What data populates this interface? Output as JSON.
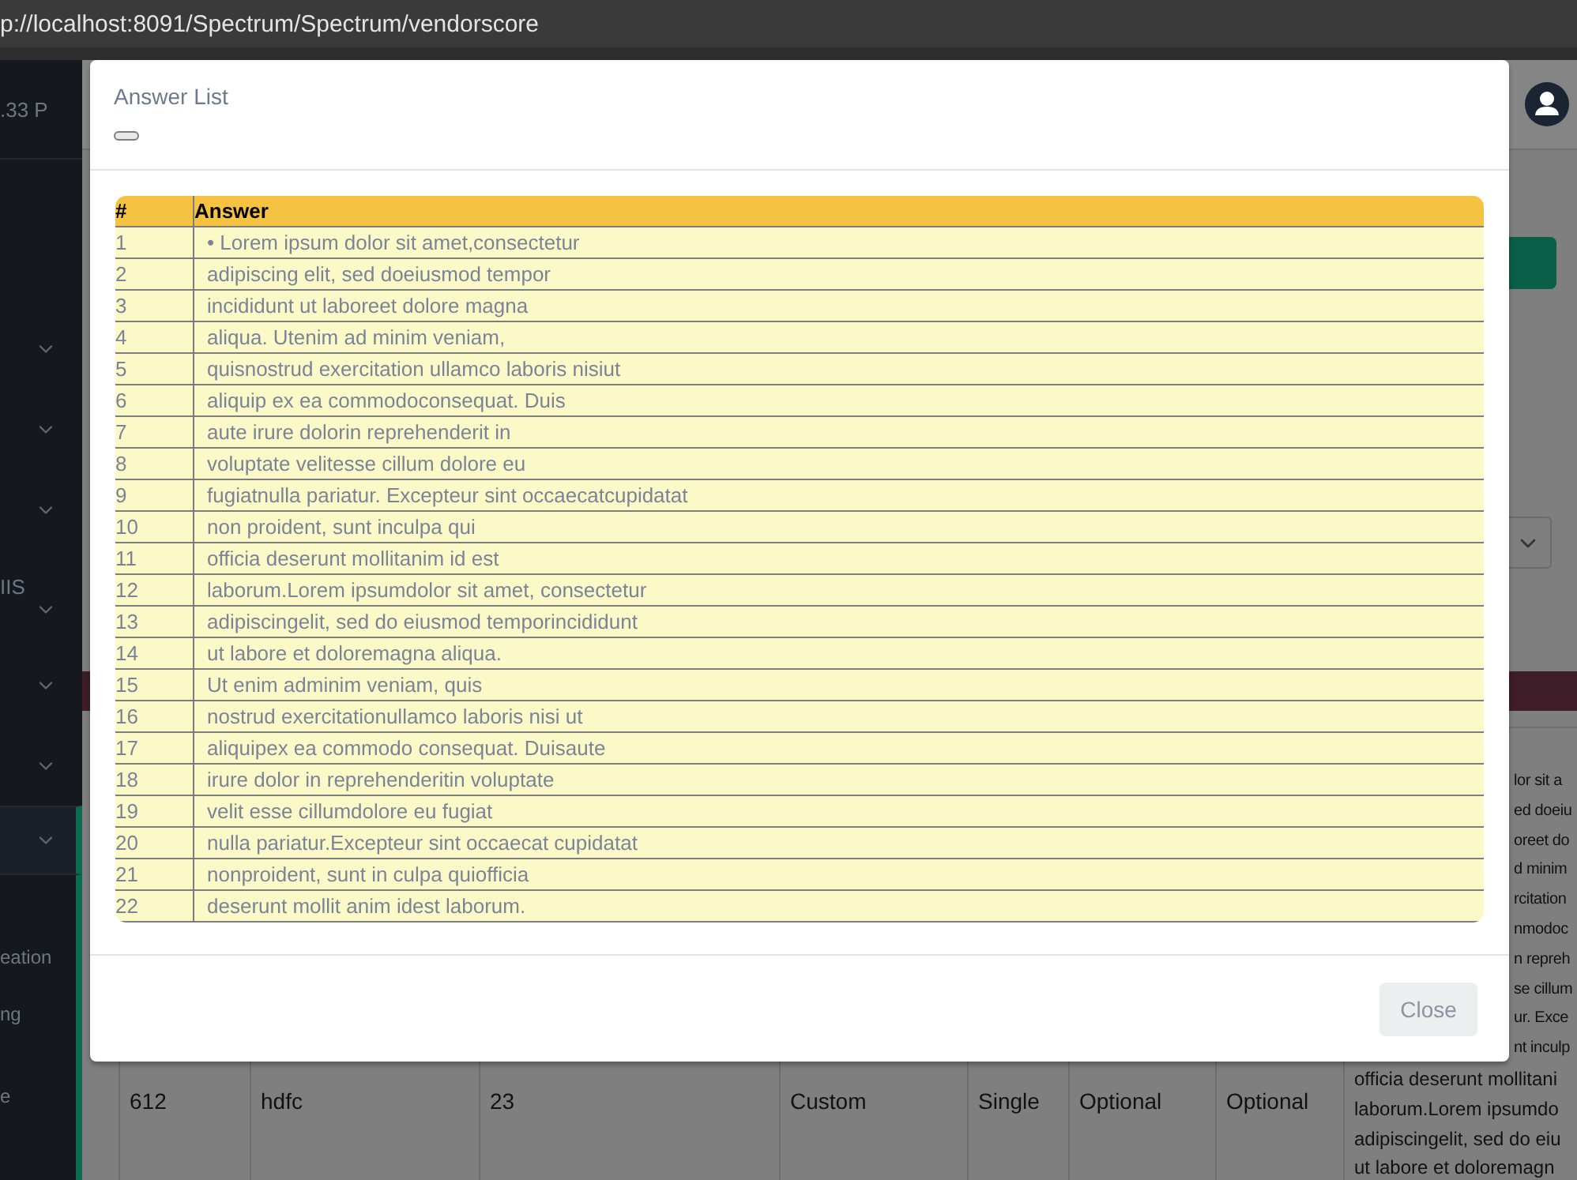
{
  "browser": {
    "url": "p://localhost:8091/Spectrum/Spectrum/vendorscore"
  },
  "sidebar": {
    "header": ".33 P",
    "items": [
      {
        "kind": "toggle",
        "selected": false
      },
      {
        "kind": "toggle",
        "selected": false
      },
      {
        "kind": "toggle",
        "selected": false
      },
      {
        "kind": "labeled",
        "label": "IIS",
        "selected": false
      },
      {
        "kind": "toggle",
        "selected": false
      },
      {
        "kind": "toggle",
        "selected": false
      },
      {
        "kind": "group",
        "selected": true,
        "children": [
          "eation",
          "ng",
          "e"
        ]
      }
    ]
  },
  "background_table": {
    "row": [
      "612",
      "hdfc",
      "23",
      "Custom",
      "Single",
      "Optional",
      "Optional"
    ],
    "long_cell_fragments": [
      "lor sit a",
      "ed doeiu",
      "oreet do",
      "d minim",
      "rcitation",
      "nmodoc",
      "n repreh",
      "se cillum",
      "ur. Exce",
      "nt inculp"
    ],
    "long_cell_lines": [
      "officia deserunt mollitani",
      "laborum.Lorem ipsumdo",
      "adipiscingelit, sed do eiu",
      "ut labore et doloremagn"
    ]
  },
  "modal": {
    "title": "Answer List",
    "columns": [
      "#",
      "Answer"
    ],
    "rows": [
      [
        "1",
        "• Lorem ipsum dolor sit amet,consectetur"
      ],
      [
        "2",
        "adipiscing elit, sed doeiusmod tempor"
      ],
      [
        "3",
        "incididunt ut laboreet dolore magna"
      ],
      [
        "4",
        "aliqua. Utenim ad minim veniam,"
      ],
      [
        "5",
        "quisnostrud exercitation ullamco laboris nisiut"
      ],
      [
        "6",
        "aliquip ex ea commodoconsequat. Duis"
      ],
      [
        "7",
        "aute irure dolorin reprehenderit in"
      ],
      [
        "8",
        "voluptate velitesse cillum dolore eu"
      ],
      [
        "9",
        "fugiatnulla pariatur. Excepteur sint occaecatcupidatat"
      ],
      [
        "10",
        "non proident, sunt inculpa qui"
      ],
      [
        "11",
        "officia deserunt mollitanim id est"
      ],
      [
        "12",
        "laborum.Lorem ipsumdolor sit amet, consectetur"
      ],
      [
        "13",
        "adipiscingelit, sed do eiusmod temporincididunt"
      ],
      [
        "14",
        "ut labore et doloremagna aliqua."
      ],
      [
        "15",
        "Ut enim adminim veniam, quis"
      ],
      [
        "16",
        "nostrud exercitationullamco laboris nisi ut"
      ],
      [
        "17",
        "aliquipex ea commodo consequat. Duisaute"
      ],
      [
        "18",
        "irure dolor in reprehenderitin voluptate"
      ],
      [
        "19",
        "velit esse cillumdolore eu fugiat"
      ],
      [
        "20",
        "nulla pariatur.Excepteur sint occaecat cupidatat"
      ],
      [
        "21",
        "nonproident, sunt in culpa quiofficia"
      ],
      [
        "22",
        "deserunt mollit anim idest laborum."
      ]
    ],
    "close_label": "Close"
  }
}
